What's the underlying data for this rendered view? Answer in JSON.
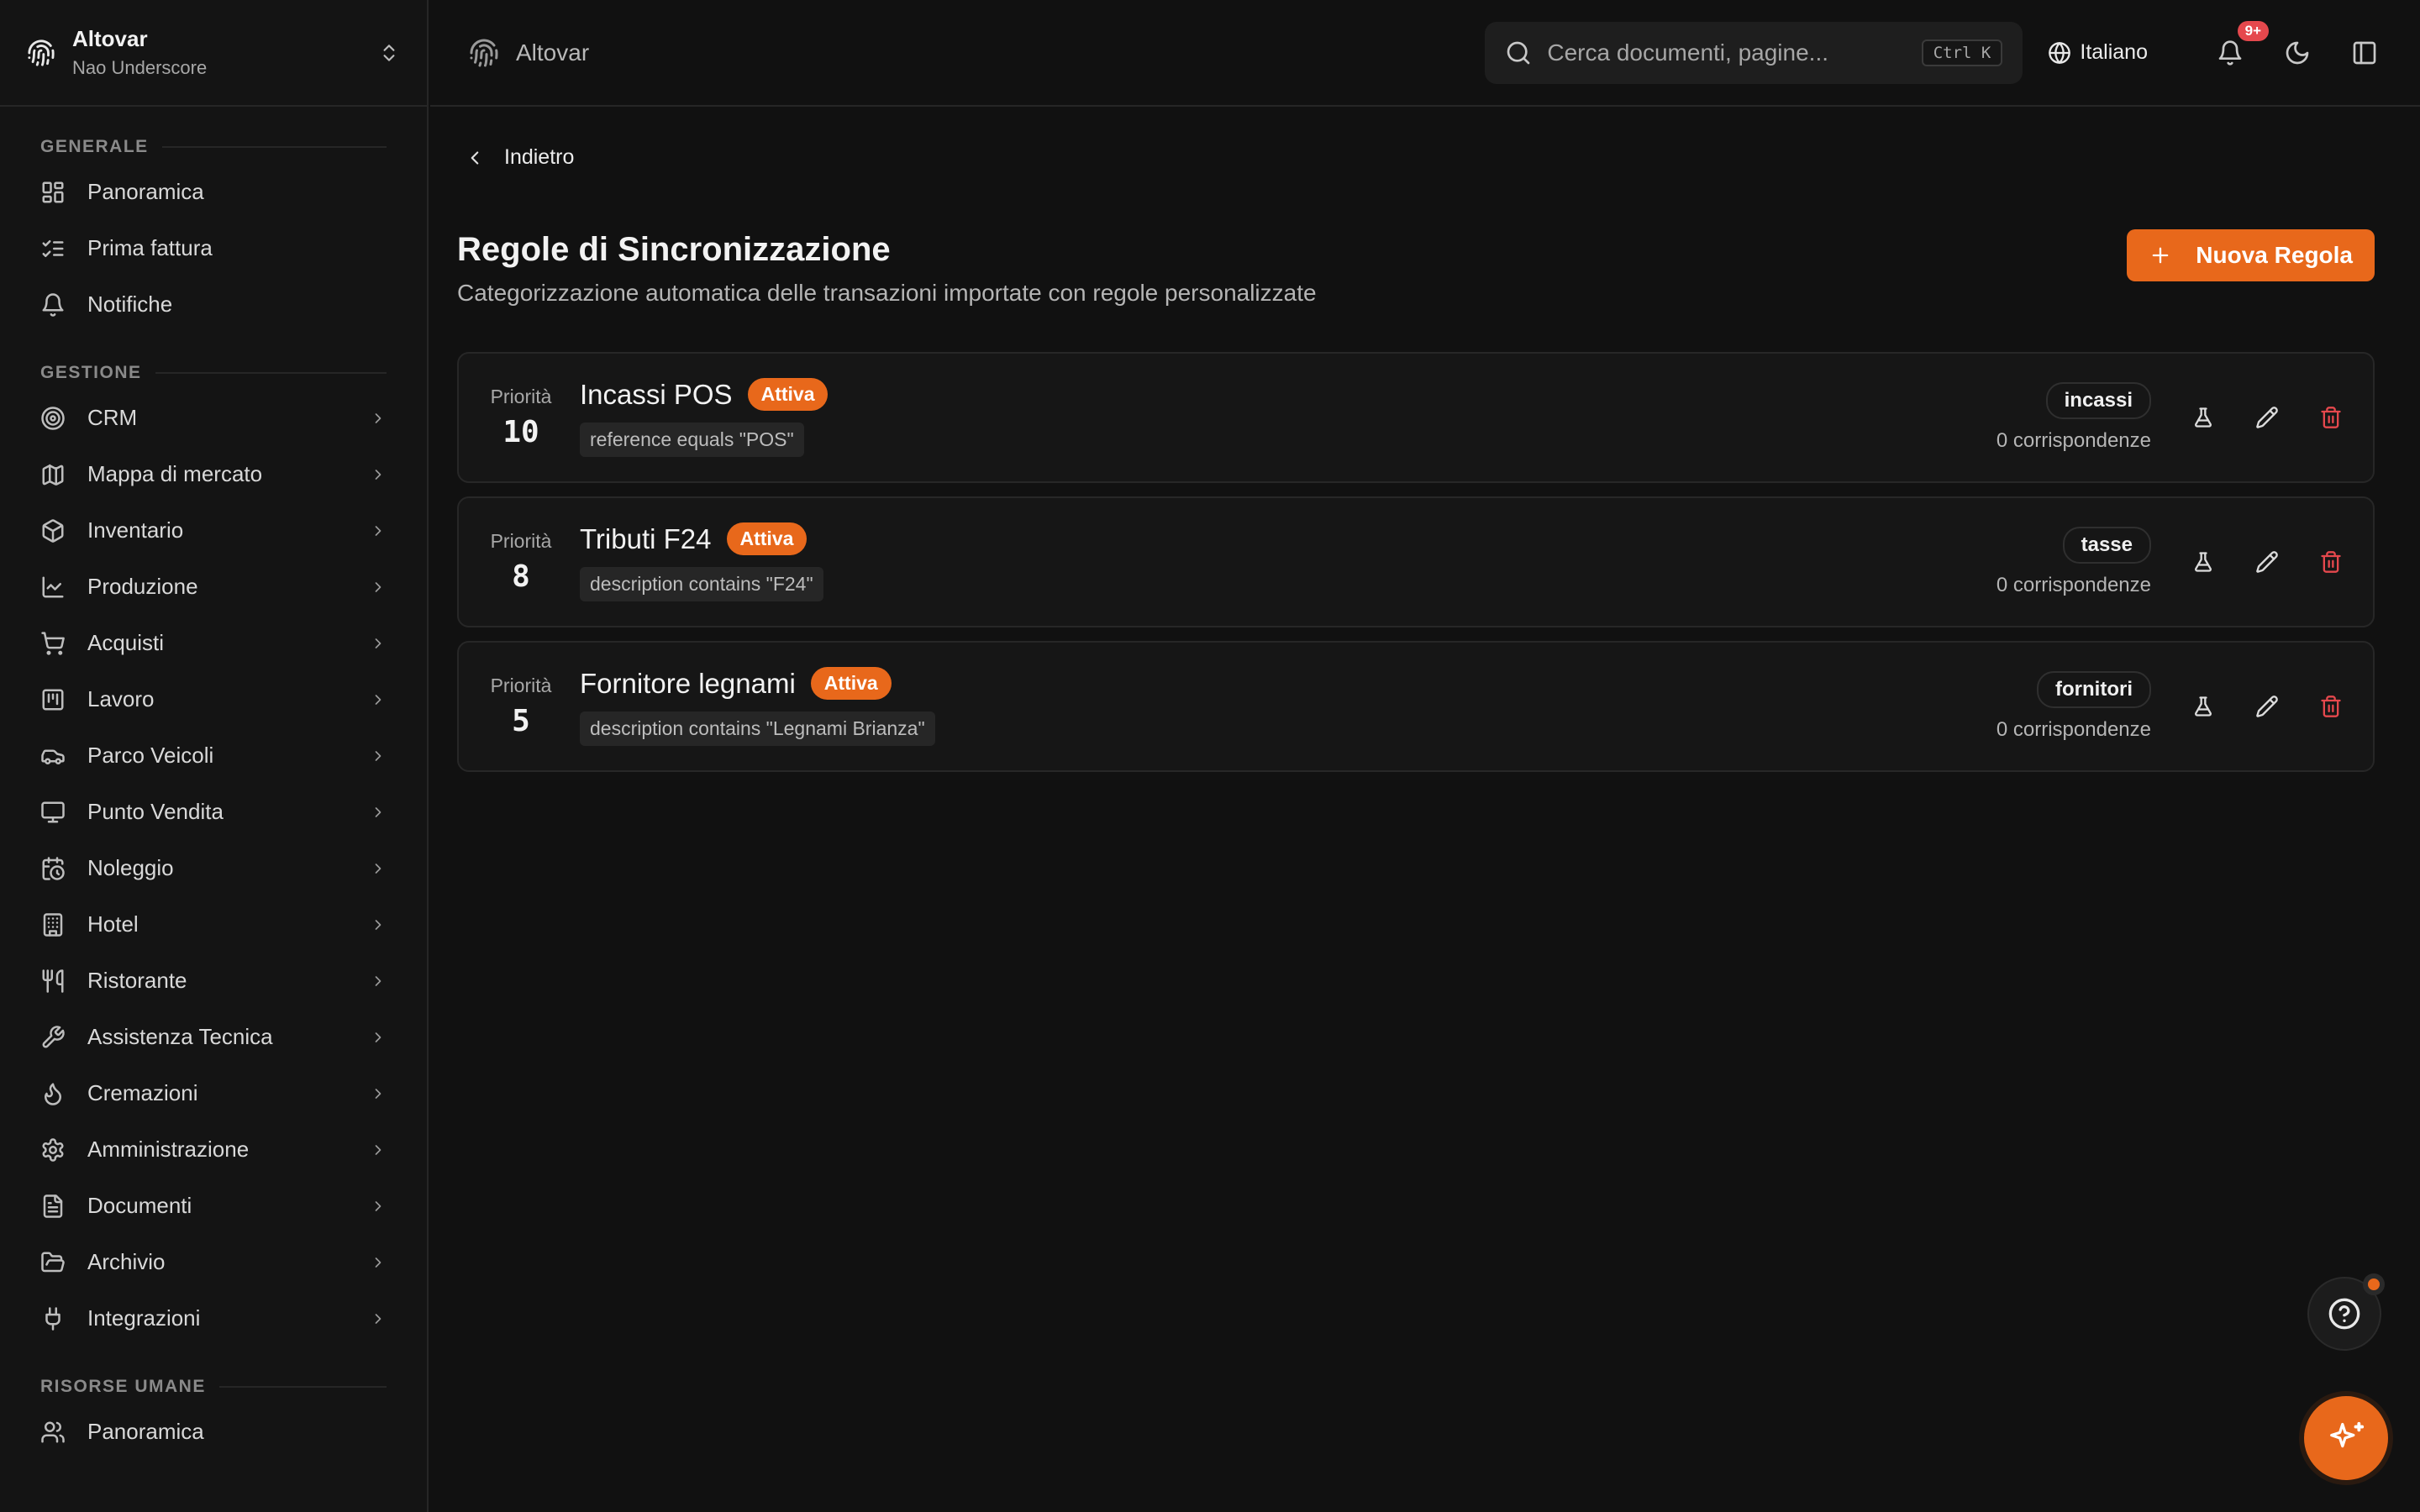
{
  "org": {
    "name": "Altovar",
    "user": "Nao Underscore"
  },
  "sidebar": {
    "sections": [
      {
        "title": "GENERALE",
        "items": [
          {
            "label": "Panoramica",
            "icon": "dashboard-icon"
          },
          {
            "label": "Prima fattura",
            "icon": "checklist-icon"
          },
          {
            "label": "Notifiche",
            "icon": "bell-icon"
          }
        ]
      },
      {
        "title": "GESTIONE",
        "items": [
          {
            "label": "CRM",
            "icon": "target-icon"
          },
          {
            "label": "Mappa di mercato",
            "icon": "map-icon"
          },
          {
            "label": "Inventario",
            "icon": "box-icon"
          },
          {
            "label": "Produzione",
            "icon": "factory-icon"
          },
          {
            "label": "Acquisti",
            "icon": "cart-icon"
          },
          {
            "label": "Lavoro",
            "icon": "kanban-icon"
          },
          {
            "label": "Parco Veicoli",
            "icon": "car-icon"
          },
          {
            "label": "Punto Vendita",
            "icon": "monitor-icon"
          },
          {
            "label": "Noleggio",
            "icon": "calendar-clock-icon"
          },
          {
            "label": "Hotel",
            "icon": "building-icon"
          },
          {
            "label": "Ristorante",
            "icon": "utensils-icon"
          },
          {
            "label": "Assistenza Tecnica",
            "icon": "wrench-icon"
          },
          {
            "label": "Cremazioni",
            "icon": "flame-icon"
          },
          {
            "label": "Amministrazione",
            "icon": "gear-icon"
          },
          {
            "label": "Documenti",
            "icon": "file-icon"
          },
          {
            "label": "Archivio",
            "icon": "folder-open-icon"
          },
          {
            "label": "Integrazioni",
            "icon": "plug-icon"
          }
        ]
      },
      {
        "title": "RISORSE UMANE",
        "items": [
          {
            "label": "Panoramica",
            "icon": "users-icon"
          }
        ]
      }
    ]
  },
  "topbar": {
    "breadcrumb": "Altovar",
    "search_placeholder": "Cerca documenti, pagine...",
    "search_shortcut": "Ctrl K",
    "language": "Italiano",
    "notification_badge": "9+"
  },
  "page": {
    "back_label": "Indietro",
    "title": "Regole di Sincronizzazione",
    "subtitle": "Categorizzazione automatica delle transazioni importate con regole personalizzate",
    "new_button": "Nuova Regola",
    "priority_label": "Priorità"
  },
  "rules": [
    {
      "priority": "10",
      "name": "Incassi POS",
      "status": "Attiva",
      "condition": "reference equals \"POS\"",
      "category": "incassi",
      "matches": "0 corrispondenze"
    },
    {
      "priority": "8",
      "name": "Tributi F24",
      "status": "Attiva",
      "condition": "description contains \"F24\"",
      "category": "tasse",
      "matches": "0 corrispondenze"
    },
    {
      "priority": "5",
      "name": "Fornitore legnami",
      "status": "Attiva",
      "condition": "description contains \"Legnami Brianza\"",
      "category": "fornitori",
      "matches": "0 corrispondenze"
    }
  ],
  "colors": {
    "accent": "#e8681b",
    "danger": "#e5484d",
    "background": "#111111"
  }
}
